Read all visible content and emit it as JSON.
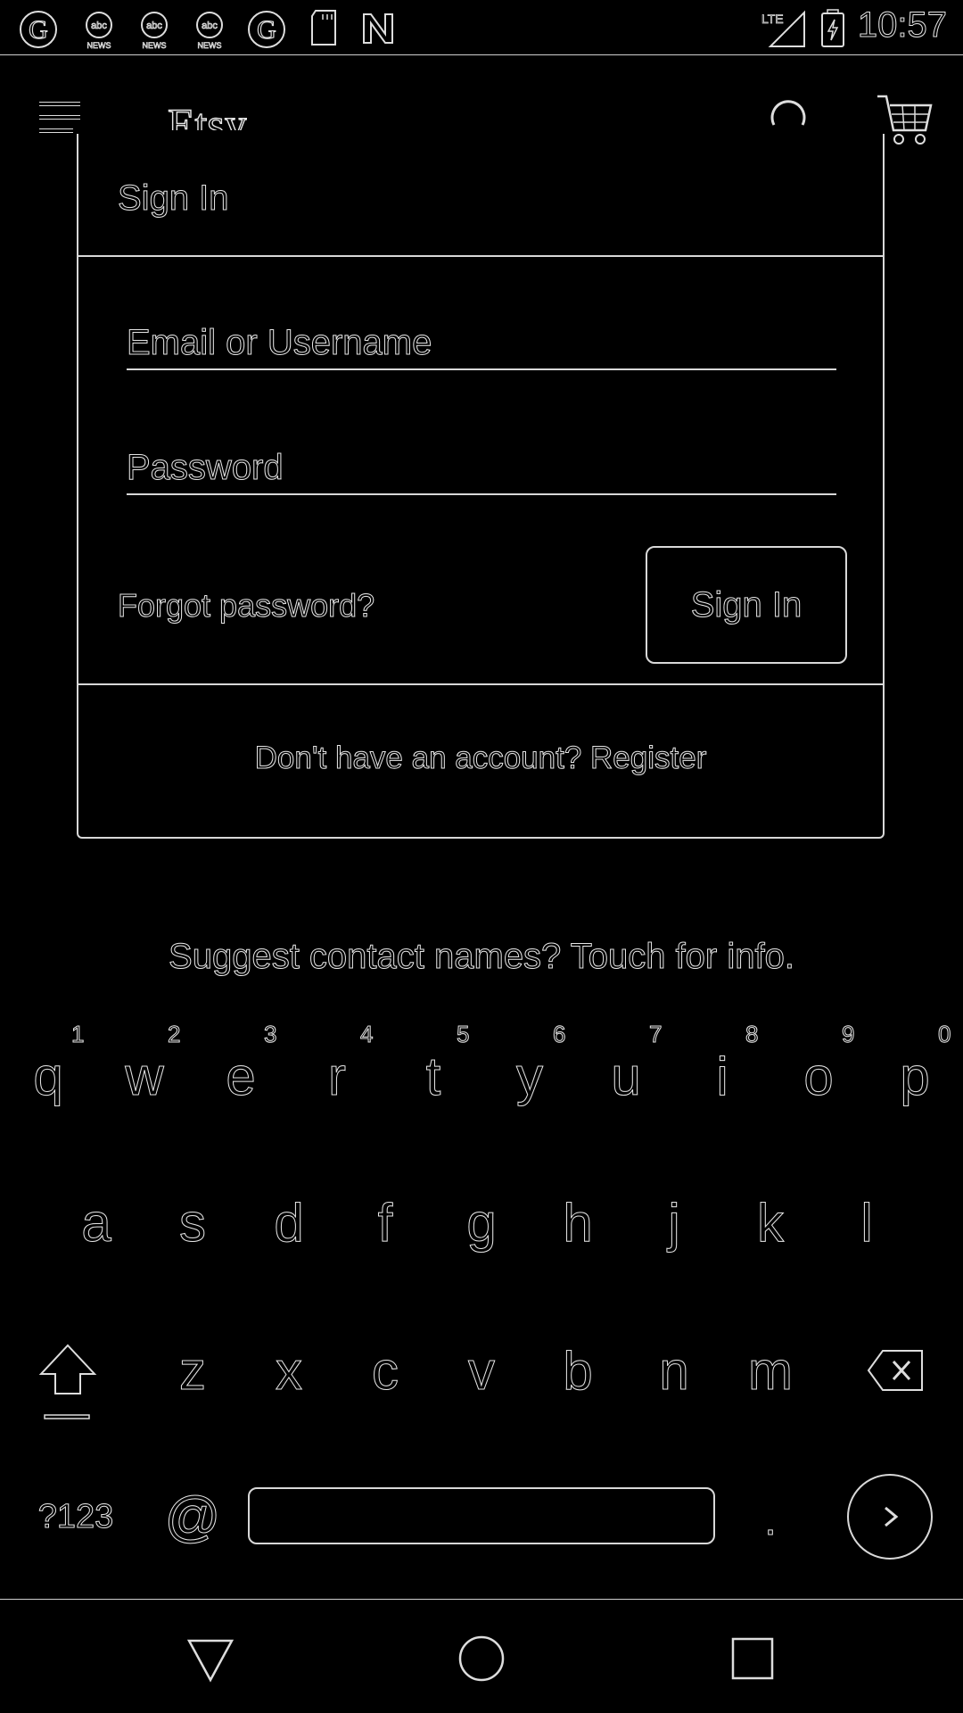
{
  "status_bar": {
    "time": "10:57",
    "network_label": "LTE",
    "notification_icons": [
      "g-icon",
      "abc-news-icon",
      "abc-news-icon",
      "abc-news-icon",
      "g-icon",
      "sd-card-icon",
      "n-icon"
    ]
  },
  "app_bar": {
    "title": "Etsy"
  },
  "card": {
    "header_title": "Sign In",
    "email_placeholder": "Email or Username",
    "password_placeholder": "Password",
    "forgot_label": "Forgot password?",
    "signin_button": "Sign In",
    "register_text": "Don't have an account? Register"
  },
  "suggest_text": "Suggest contact names? Touch for info.",
  "keyboard": {
    "row1": [
      "q",
      "w",
      "e",
      "r",
      "t",
      "y",
      "u",
      "i",
      "o",
      "p"
    ],
    "row1_hints": [
      "1",
      "2",
      "3",
      "4",
      "5",
      "6",
      "7",
      "8",
      "9",
      "0"
    ],
    "row2": [
      "a",
      "s",
      "d",
      "f",
      "g",
      "h",
      "j",
      "k",
      "l"
    ],
    "row3": [
      "z",
      "x",
      "c",
      "v",
      "b",
      "n",
      "m"
    ],
    "symbols_key": "?123",
    "at_key": "@",
    "period_key": "."
  }
}
